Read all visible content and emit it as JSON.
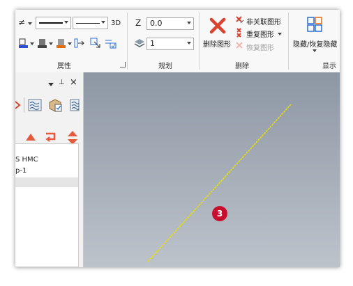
{
  "ribbon": {
    "linetype_symbol": "≠",
    "label_3d": "3D",
    "groups": {
      "properties": "属性",
      "planning": "规划",
      "delete": "删除",
      "display": "显示"
    },
    "z_label": "Z",
    "z_value": "0.0",
    "layer_value": "1",
    "delete_shape": "删除图形",
    "unrelated_shapes": "非关联图形",
    "duplicate_shapes": "重复图形",
    "restore_shapes": "恢复图形",
    "hide_restore": "隐藏/恢复隐藏"
  },
  "panel": {
    "pin_symbol": "⊥",
    "close_symbol": "×",
    "tree": [
      "S HMC",
      "p-1"
    ]
  },
  "viewport": {
    "badge": "3",
    "line_color": "#e8e000"
  },
  "colors": {
    "accent_red": "#c8102e",
    "delete_red": "#d9432f"
  }
}
